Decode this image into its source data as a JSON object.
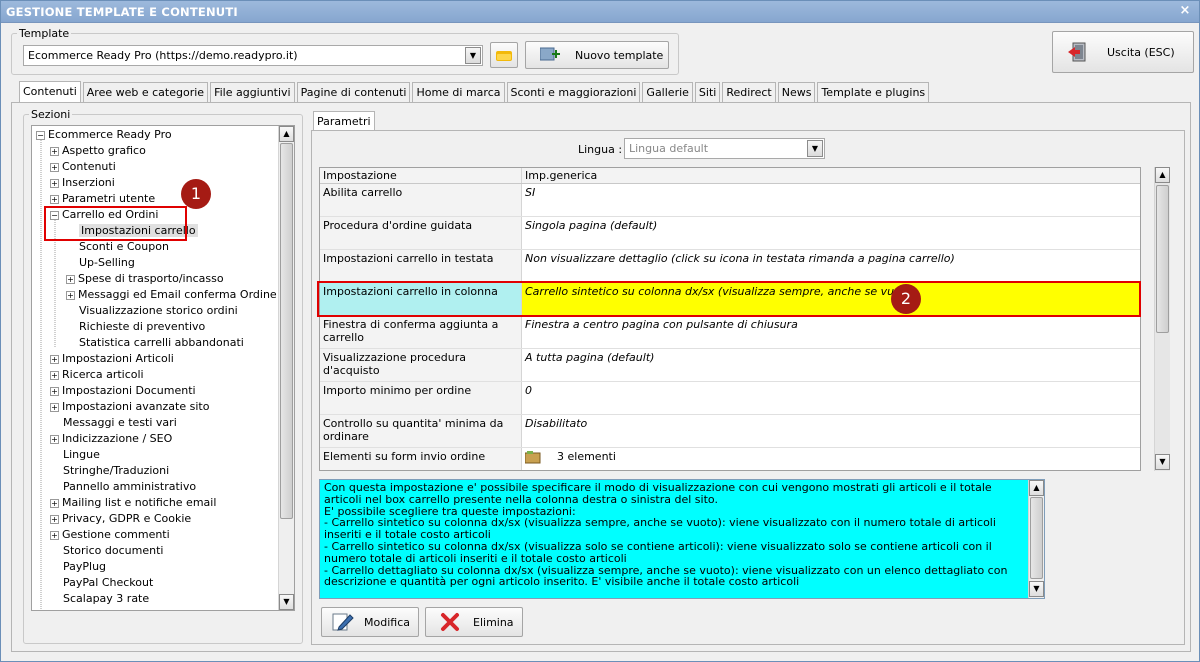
{
  "window": {
    "title": "GESTIONE TEMPLATE E CONTENUTI",
    "close": "×"
  },
  "template_group": {
    "label": "Template",
    "selected": "Ecommerce Ready Pro (https://demo.readypro.it)",
    "new_button": "Nuovo template"
  },
  "exit_button": "Uscita (ESC)",
  "tabs": [
    "Contenuti",
    "Aree web e categorie",
    "File aggiuntivi",
    "Pagine di contenuti",
    "Home di marca",
    "Sconti e maggiorazioni",
    "Gallerie",
    "Siti",
    "Redirect",
    "News",
    "Template e plugins"
  ],
  "sections": {
    "label": "Sezioni",
    "tree": [
      {
        "label": "Ecommerce Ready Pro",
        "level": 0,
        "exp": "−"
      },
      {
        "label": "Aspetto grafico",
        "level": 1,
        "exp": "+"
      },
      {
        "label": "Contenuti",
        "level": 1,
        "exp": "+"
      },
      {
        "label": "Inserzioni",
        "level": 1,
        "exp": "+"
      },
      {
        "label": "Parametri utente",
        "level": 1,
        "exp": "+"
      },
      {
        "label": "Carrello ed Ordini",
        "level": 1,
        "exp": "−"
      },
      {
        "label": "Impostazioni carrello",
        "level": 2,
        "exp": "",
        "selected": true
      },
      {
        "label": "Sconti e Coupon",
        "level": 2,
        "exp": ""
      },
      {
        "label": "Up-Selling",
        "level": 2,
        "exp": ""
      },
      {
        "label": "Spese di trasporto/incasso",
        "level": 2,
        "exp": "+"
      },
      {
        "label": "Messaggi ed Email conferma Ordine",
        "level": 2,
        "exp": "+"
      },
      {
        "label": "Visualizzazione storico ordini",
        "level": 2,
        "exp": ""
      },
      {
        "label": "Richieste di preventivo",
        "level": 2,
        "exp": ""
      },
      {
        "label": "Statistica carrelli abbandonati",
        "level": 2,
        "exp": ""
      },
      {
        "label": "Impostazioni Articoli",
        "level": 1,
        "exp": "+"
      },
      {
        "label": "Ricerca articoli",
        "level": 1,
        "exp": "+"
      },
      {
        "label": "Impostazioni Documenti",
        "level": 1,
        "exp": "+"
      },
      {
        "label": "Impostazioni avanzate sito",
        "level": 1,
        "exp": "+"
      },
      {
        "label": "Messaggi e testi vari",
        "level": 1,
        "exp": ""
      },
      {
        "label": "Indicizzazione / SEO",
        "level": 1,
        "exp": "+"
      },
      {
        "label": "Lingue",
        "level": 1,
        "exp": ""
      },
      {
        "label": "Stringhe/Traduzioni",
        "level": 1,
        "exp": ""
      },
      {
        "label": "Pannello amministrativo",
        "level": 1,
        "exp": ""
      },
      {
        "label": "Mailing list e notifiche email",
        "level": 1,
        "exp": "+"
      },
      {
        "label": "Privacy, GDPR e Cookie",
        "level": 1,
        "exp": "+"
      },
      {
        "label": "Gestione commenti",
        "level": 1,
        "exp": "+"
      },
      {
        "label": "Storico documenti",
        "level": 1,
        "exp": ""
      },
      {
        "label": "PayPlug",
        "level": 1,
        "exp": ""
      },
      {
        "label": "PayPal Checkout",
        "level": 1,
        "exp": ""
      },
      {
        "label": "Scalapay 3 rate",
        "level": 1,
        "exp": ""
      }
    ]
  },
  "params": {
    "tab": "Parametri",
    "lingua_label": "Lingua :",
    "lingua_value": "Lingua default",
    "col1": "Impostazione",
    "col2": "Imp.generica",
    "rows": [
      {
        "name": "Abilita carrello",
        "value": "SI"
      },
      {
        "name": "Procedura d'ordine guidata",
        "value": "Singola pagina (default)"
      },
      {
        "name": "Impostazioni carrello in testata",
        "value": "Non visualizzare dettaglio (click su icona in testata rimanda a pagina carrello)"
      },
      {
        "name": "Impostazioni carrello in colonna",
        "value": "Carrello sintetico su colonna dx/sx (visualizza sempre, anche se vuoto)",
        "highlight": true
      },
      {
        "name": "Finestra di conferma aggiunta a carrello",
        "value": "Finestra a centro pagina con pulsante di chiusura"
      },
      {
        "name": "Visualizzazione procedura d'acquisto",
        "value": "A tutta pagina (default)"
      },
      {
        "name": "Importo minimo per ordine",
        "value": "0"
      },
      {
        "name": "Controllo su quantita' minima da ordinare",
        "value": "Disabilitato"
      },
      {
        "name": "Elementi su form invio ordine",
        "value": "3 elementi",
        "plain": true
      }
    ],
    "description": [
      "Con questa impostazione e' possibile specificare il modo di visualizzazione con cui vengono mostrati gli articoli e il totale articoli nel box carrello presente nella colonna destra o sinistra del sito.",
      "E' possibile scegliere tra queste impostazioni:",
      "- Carrello sintetico su colonna dx/sx (visualizza sempre, anche se vuoto): viene visualizzato con il numero totale di articoli inseriti e il totale costo articoli",
      "- Carrello sintetico su colonna dx/sx (visualizza solo se contiene articoli): viene visualizzato solo se contiene articoli con il numero totale di articoli inseriti e il totale costo articoli",
      "- Carrello dettagliato su colonna dx/sx (visualizza sempre, anche se vuoto): viene visualizzato con un elenco dettagliato con descrizione e quantità per ogni articolo inserito. E' visibile anche il totale costo articoli"
    ],
    "modify_button": "Modifica",
    "delete_button": "Elimina"
  },
  "badges": [
    "1",
    "2"
  ],
  "colors": {
    "highlight": "#ffff00",
    "highlight_name": "#b0f0f0",
    "desc_bg": "#00ffff",
    "annot_red": "#e00000",
    "badge": "#a51b14"
  }
}
